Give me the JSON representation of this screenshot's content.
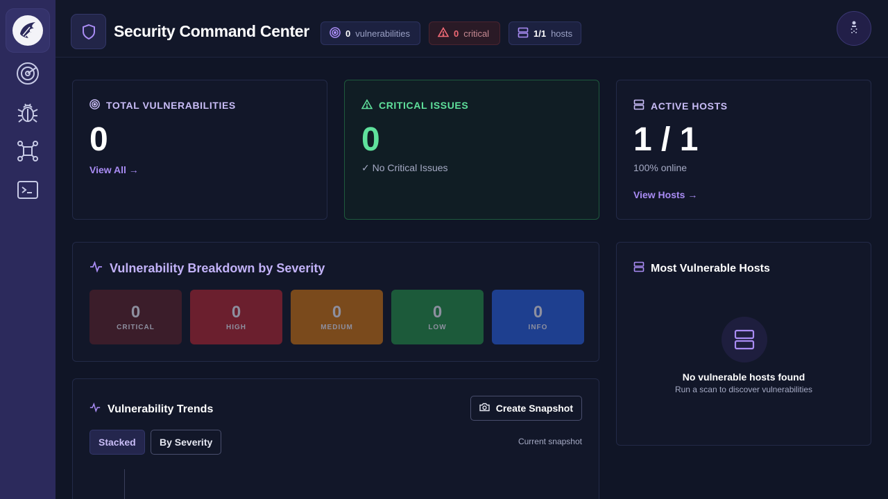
{
  "app": {
    "title": "Security Command Center"
  },
  "header": {
    "pills": {
      "vulnerabilities": {
        "count": "0",
        "label": "vulnerabilities"
      },
      "critical": {
        "count": "0",
        "label": "critical"
      },
      "hosts": {
        "count": "1/1",
        "label": "hosts"
      }
    }
  },
  "sidebar": {
    "items": [
      {
        "icon": "radar-icon"
      },
      {
        "icon": "bug-icon"
      },
      {
        "icon": "network-icon"
      },
      {
        "icon": "terminal-icon"
      }
    ]
  },
  "stats": {
    "total_vulnerabilities": {
      "label": "TOTAL VULNERABILITIES",
      "value": "0",
      "link": "View All →"
    },
    "critical_issues": {
      "label": "CRITICAL ISSUES",
      "value": "0",
      "sub": "✓ No Critical Issues"
    },
    "active_hosts": {
      "label": "ACTIVE HOSTS",
      "value": "1 / 1",
      "sub": "100% online",
      "link": "View Hosts →"
    }
  },
  "breakdown": {
    "title": "Vulnerability Breakdown by Severity",
    "severities": [
      {
        "label": "CRITICAL",
        "value": "0",
        "color": "#3b1d2a"
      },
      {
        "label": "HIGH",
        "value": "0",
        "color": "#6b1f2e"
      },
      {
        "label": "MEDIUM",
        "value": "0",
        "color": "#7a4a1c"
      },
      {
        "label": "LOW",
        "value": "0",
        "color": "#1c5a3a"
      },
      {
        "label": "INFO",
        "value": "0",
        "color": "#1e3f8f"
      }
    ]
  },
  "trends": {
    "title": "Vulnerability Trends",
    "snapshot_button": "Create Snapshot",
    "tabs": [
      "Stacked",
      "By Severity"
    ],
    "note": "Current snapshot"
  },
  "hosts_panel": {
    "title": "Most Vulnerable Hosts",
    "empty_title": "No vulnerable hosts found",
    "empty_sub": "Run a scan to discover vulnerabilities"
  }
}
